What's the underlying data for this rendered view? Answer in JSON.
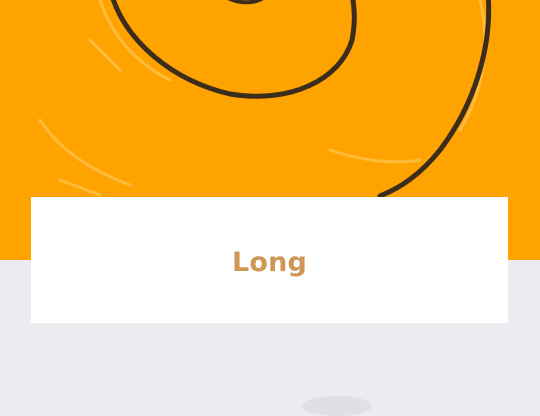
{
  "card": {
    "title": "Long"
  },
  "colors": {
    "hero_background": "#ffa300",
    "page_background": "#ecebf0",
    "card_background": "#ffffff",
    "title_color": "#cf9655",
    "drawing_stroke": "#3b2c1c"
  },
  "hero": {
    "image": "spiral-drawing"
  }
}
